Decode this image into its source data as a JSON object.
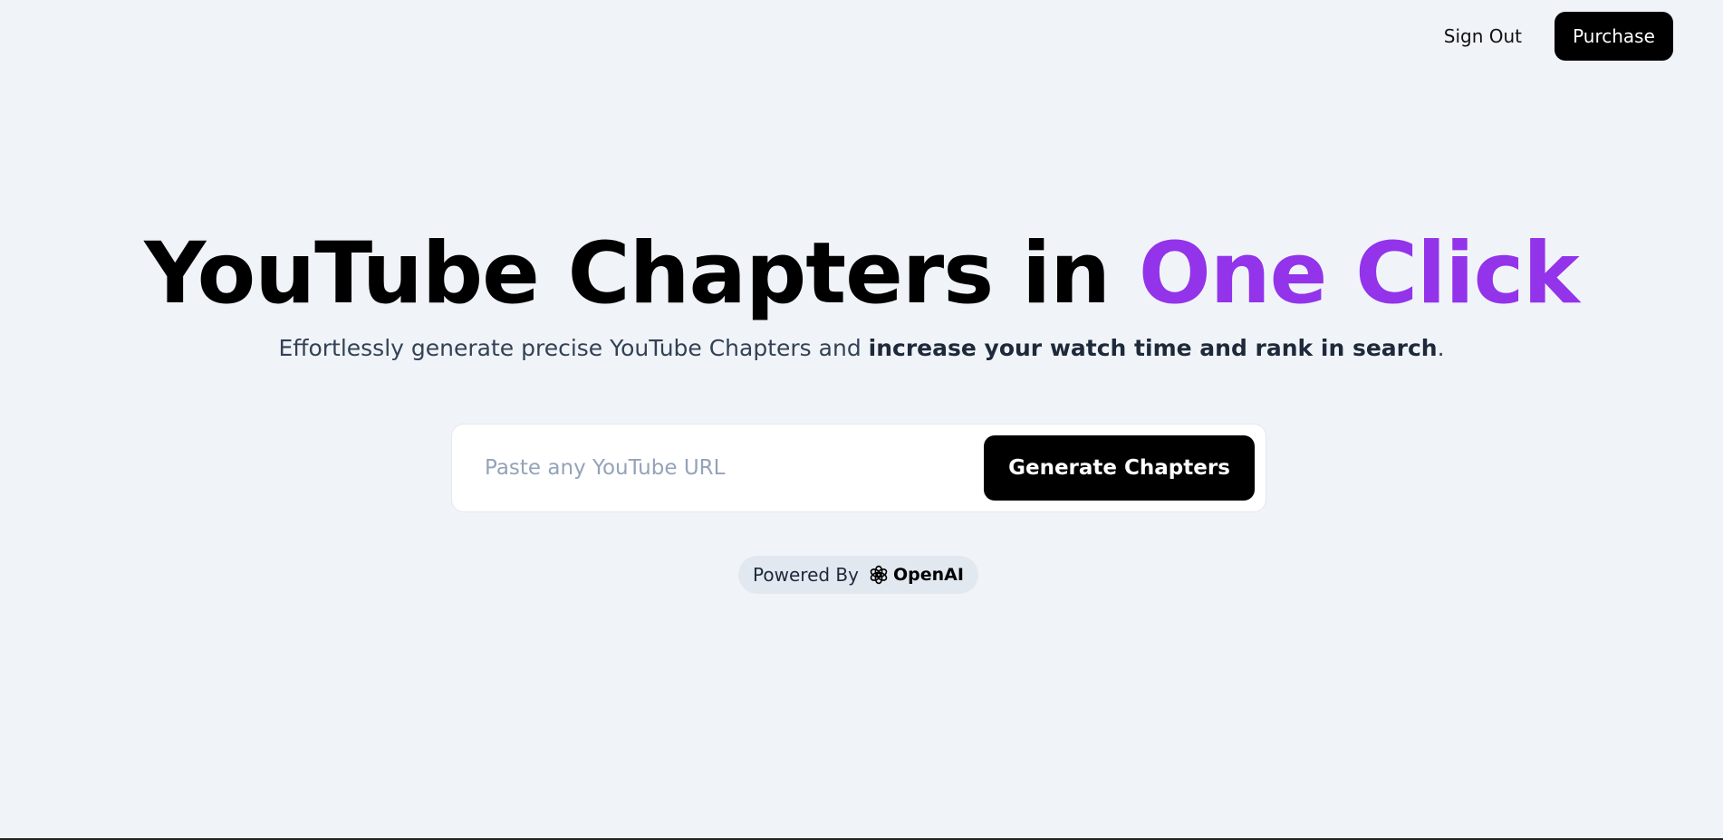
{
  "nav": {
    "sign_out": "Sign Out",
    "purchase": "Purchase"
  },
  "hero": {
    "title_main": "YouTube Chapters in ",
    "title_accent": "One Click",
    "accent_color": "#9333ea",
    "subtitle_plain": "Effortlessly generate precise YouTube Chapters and ",
    "subtitle_bold": "increase your watch time and rank in search",
    "subtitle_end": "."
  },
  "search": {
    "placeholder": "Paste any YouTube URL",
    "value": "",
    "button_label": "Generate Chapters"
  },
  "powered": {
    "label": "Powered By",
    "brand": "OpenAI",
    "brand_icon": "openai-logo-icon"
  }
}
